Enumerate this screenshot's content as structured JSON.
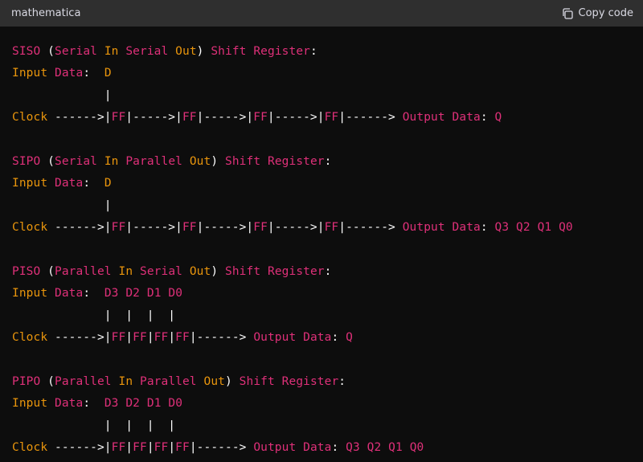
{
  "header": {
    "language": "mathematica",
    "copy_label": "Copy code"
  },
  "lines": [
    [
      {
        "t": "SISO",
        "c": "pink"
      },
      {
        "t": " (",
        "c": "white"
      },
      {
        "t": "Serial",
        "c": "pink"
      },
      {
        "t": " ",
        "c": "white"
      },
      {
        "t": "In",
        "c": "orange"
      },
      {
        "t": " ",
        "c": "white"
      },
      {
        "t": "Serial",
        "c": "pink"
      },
      {
        "t": " ",
        "c": "white"
      },
      {
        "t": "Out",
        "c": "orange"
      },
      {
        "t": ") ",
        "c": "white"
      },
      {
        "t": "Shift",
        "c": "pink"
      },
      {
        "t": " ",
        "c": "white"
      },
      {
        "t": "Register",
        "c": "pink"
      },
      {
        "t": ":",
        "c": "white"
      }
    ],
    [
      {
        "t": "Input",
        "c": "orange"
      },
      {
        "t": " ",
        "c": "white"
      },
      {
        "t": "Data",
        "c": "pink"
      },
      {
        "t": ":  ",
        "c": "white"
      },
      {
        "t": "D",
        "c": "orange"
      }
    ],
    [
      {
        "t": "             |",
        "c": "white"
      }
    ],
    [
      {
        "t": "Clock",
        "c": "orange"
      },
      {
        "t": " ------>|",
        "c": "white"
      },
      {
        "t": "FF",
        "c": "pink"
      },
      {
        "t": "|----->|",
        "c": "white"
      },
      {
        "t": "FF",
        "c": "pink"
      },
      {
        "t": "|----->|",
        "c": "white"
      },
      {
        "t": "FF",
        "c": "pink"
      },
      {
        "t": "|----->|",
        "c": "white"
      },
      {
        "t": "FF",
        "c": "pink"
      },
      {
        "t": "|------> ",
        "c": "white"
      },
      {
        "t": "Output",
        "c": "pink"
      },
      {
        "t": " ",
        "c": "white"
      },
      {
        "t": "Data",
        "c": "pink"
      },
      {
        "t": ": ",
        "c": "white"
      },
      {
        "t": "Q",
        "c": "pink"
      }
    ],
    [],
    [
      {
        "t": "SIPO",
        "c": "pink"
      },
      {
        "t": " (",
        "c": "white"
      },
      {
        "t": "Serial",
        "c": "pink"
      },
      {
        "t": " ",
        "c": "white"
      },
      {
        "t": "In",
        "c": "orange"
      },
      {
        "t": " ",
        "c": "white"
      },
      {
        "t": "Parallel",
        "c": "pink"
      },
      {
        "t": " ",
        "c": "white"
      },
      {
        "t": "Out",
        "c": "orange"
      },
      {
        "t": ") ",
        "c": "white"
      },
      {
        "t": "Shift",
        "c": "pink"
      },
      {
        "t": " ",
        "c": "white"
      },
      {
        "t": "Register",
        "c": "pink"
      },
      {
        "t": ":",
        "c": "white"
      }
    ],
    [
      {
        "t": "Input",
        "c": "orange"
      },
      {
        "t": " ",
        "c": "white"
      },
      {
        "t": "Data",
        "c": "pink"
      },
      {
        "t": ":  ",
        "c": "white"
      },
      {
        "t": "D",
        "c": "orange"
      }
    ],
    [
      {
        "t": "             |",
        "c": "white"
      }
    ],
    [
      {
        "t": "Clock",
        "c": "orange"
      },
      {
        "t": " ------>|",
        "c": "white"
      },
      {
        "t": "FF",
        "c": "pink"
      },
      {
        "t": "|----->|",
        "c": "white"
      },
      {
        "t": "FF",
        "c": "pink"
      },
      {
        "t": "|----->|",
        "c": "white"
      },
      {
        "t": "FF",
        "c": "pink"
      },
      {
        "t": "|----->|",
        "c": "white"
      },
      {
        "t": "FF",
        "c": "pink"
      },
      {
        "t": "|------> ",
        "c": "white"
      },
      {
        "t": "Output",
        "c": "pink"
      },
      {
        "t": " ",
        "c": "white"
      },
      {
        "t": "Data",
        "c": "pink"
      },
      {
        "t": ": ",
        "c": "white"
      },
      {
        "t": "Q3",
        "c": "pink"
      },
      {
        "t": " ",
        "c": "white"
      },
      {
        "t": "Q2",
        "c": "pink"
      },
      {
        "t": " ",
        "c": "white"
      },
      {
        "t": "Q1",
        "c": "pink"
      },
      {
        "t": " ",
        "c": "white"
      },
      {
        "t": "Q0",
        "c": "pink"
      }
    ],
    [],
    [
      {
        "t": "PISO",
        "c": "pink"
      },
      {
        "t": " (",
        "c": "white"
      },
      {
        "t": "Parallel",
        "c": "pink"
      },
      {
        "t": " ",
        "c": "white"
      },
      {
        "t": "In",
        "c": "orange"
      },
      {
        "t": " ",
        "c": "white"
      },
      {
        "t": "Serial",
        "c": "pink"
      },
      {
        "t": " ",
        "c": "white"
      },
      {
        "t": "Out",
        "c": "orange"
      },
      {
        "t": ") ",
        "c": "white"
      },
      {
        "t": "Shift",
        "c": "pink"
      },
      {
        "t": " ",
        "c": "white"
      },
      {
        "t": "Register",
        "c": "pink"
      },
      {
        "t": ":",
        "c": "white"
      }
    ],
    [
      {
        "t": "Input",
        "c": "orange"
      },
      {
        "t": " ",
        "c": "white"
      },
      {
        "t": "Data",
        "c": "pink"
      },
      {
        "t": ":  ",
        "c": "white"
      },
      {
        "t": "D3",
        "c": "pink"
      },
      {
        "t": " ",
        "c": "white"
      },
      {
        "t": "D2",
        "c": "pink"
      },
      {
        "t": " ",
        "c": "white"
      },
      {
        "t": "D1",
        "c": "pink"
      },
      {
        "t": " ",
        "c": "white"
      },
      {
        "t": "D0",
        "c": "pink"
      }
    ],
    [
      {
        "t": "             |  |  |  |",
        "c": "white"
      }
    ],
    [
      {
        "t": "Clock",
        "c": "orange"
      },
      {
        "t": " ------>|",
        "c": "white"
      },
      {
        "t": "FF",
        "c": "pink"
      },
      {
        "t": "|",
        "c": "white"
      },
      {
        "t": "FF",
        "c": "pink"
      },
      {
        "t": "|",
        "c": "white"
      },
      {
        "t": "FF",
        "c": "pink"
      },
      {
        "t": "|",
        "c": "white"
      },
      {
        "t": "FF",
        "c": "pink"
      },
      {
        "t": "|------> ",
        "c": "white"
      },
      {
        "t": "Output",
        "c": "pink"
      },
      {
        "t": " ",
        "c": "white"
      },
      {
        "t": "Data",
        "c": "pink"
      },
      {
        "t": ": ",
        "c": "white"
      },
      {
        "t": "Q",
        "c": "pink"
      }
    ],
    [],
    [
      {
        "t": "PIPO",
        "c": "pink"
      },
      {
        "t": " (",
        "c": "white"
      },
      {
        "t": "Parallel",
        "c": "pink"
      },
      {
        "t": " ",
        "c": "white"
      },
      {
        "t": "In",
        "c": "orange"
      },
      {
        "t": " ",
        "c": "white"
      },
      {
        "t": "Parallel",
        "c": "pink"
      },
      {
        "t": " ",
        "c": "white"
      },
      {
        "t": "Out",
        "c": "orange"
      },
      {
        "t": ") ",
        "c": "white"
      },
      {
        "t": "Shift",
        "c": "pink"
      },
      {
        "t": " ",
        "c": "white"
      },
      {
        "t": "Register",
        "c": "pink"
      },
      {
        "t": ":",
        "c": "white"
      }
    ],
    [
      {
        "t": "Input",
        "c": "orange"
      },
      {
        "t": " ",
        "c": "white"
      },
      {
        "t": "Data",
        "c": "pink"
      },
      {
        "t": ":  ",
        "c": "white"
      },
      {
        "t": "D3",
        "c": "pink"
      },
      {
        "t": " ",
        "c": "white"
      },
      {
        "t": "D2",
        "c": "pink"
      },
      {
        "t": " ",
        "c": "white"
      },
      {
        "t": "D1",
        "c": "pink"
      },
      {
        "t": " ",
        "c": "white"
      },
      {
        "t": "D0",
        "c": "pink"
      }
    ],
    [
      {
        "t": "             |  |  |  |",
        "c": "white"
      }
    ],
    [
      {
        "t": "Clock",
        "c": "orange"
      },
      {
        "t": " ------>|",
        "c": "white"
      },
      {
        "t": "FF",
        "c": "pink"
      },
      {
        "t": "|",
        "c": "white"
      },
      {
        "t": "FF",
        "c": "pink"
      },
      {
        "t": "|",
        "c": "white"
      },
      {
        "t": "FF",
        "c": "pink"
      },
      {
        "t": "|",
        "c": "white"
      },
      {
        "t": "FF",
        "c": "pink"
      },
      {
        "t": "|------> ",
        "c": "white"
      },
      {
        "t": "Output",
        "c": "pink"
      },
      {
        "t": " ",
        "c": "white"
      },
      {
        "t": "Data",
        "c": "pink"
      },
      {
        "t": ": ",
        "c": "white"
      },
      {
        "t": "Q3",
        "c": "pink"
      },
      {
        "t": " ",
        "c": "white"
      },
      {
        "t": "Q2",
        "c": "pink"
      },
      {
        "t": " ",
        "c": "white"
      },
      {
        "t": "Q1",
        "c": "pink"
      },
      {
        "t": " ",
        "c": "white"
      },
      {
        "t": "Q0",
        "c": "pink"
      }
    ]
  ],
  "colors": {
    "pink": "#df3079",
    "orange": "#e9950c",
    "white": "#ffffff",
    "header_bg": "#2f2f2f",
    "code_bg": "#0d0d0d"
  },
  "icons": {
    "copy": "copy-icon"
  }
}
